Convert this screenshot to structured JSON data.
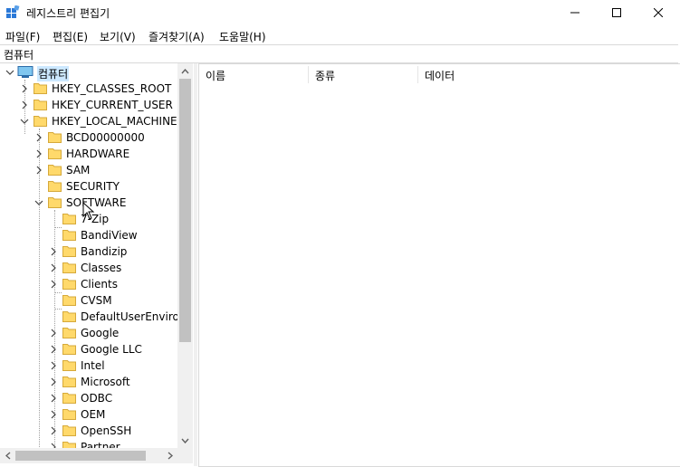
{
  "window": {
    "title": "레지스트리 편집기"
  },
  "menu": [
    "파일(F)",
    "편집(E)",
    "보기(V)",
    "즐겨찾기(A)",
    "도움말(H)"
  ],
  "address": "컴퓨터",
  "tree": {
    "root": "컴퓨터",
    "hives": [
      {
        "label": "HKEY_CLASSES_ROOT"
      },
      {
        "label": "HKEY_CURRENT_USER"
      },
      {
        "label": "HKEY_LOCAL_MACHINE"
      }
    ],
    "hklm_children": [
      {
        "label": "BCD00000000"
      },
      {
        "label": "HARDWARE"
      },
      {
        "label": "SAM"
      },
      {
        "label": "SECURITY"
      },
      {
        "label": "SOFTWARE"
      }
    ],
    "software_children": [
      {
        "label": "7-Zip"
      },
      {
        "label": "BandiView"
      },
      {
        "label": "Bandizip"
      },
      {
        "label": "Classes"
      },
      {
        "label": "Clients"
      },
      {
        "label": "CVSM"
      },
      {
        "label": "DefaultUserEnvironm"
      },
      {
        "label": "Google"
      },
      {
        "label": "Google LLC"
      },
      {
        "label": "Intel"
      },
      {
        "label": "Microsoft"
      },
      {
        "label": "ODBC"
      },
      {
        "label": "OEM"
      },
      {
        "label": "OpenSSH"
      },
      {
        "label": "Partner"
      }
    ]
  },
  "columns": [
    "이름",
    "종류",
    "데이터"
  ]
}
